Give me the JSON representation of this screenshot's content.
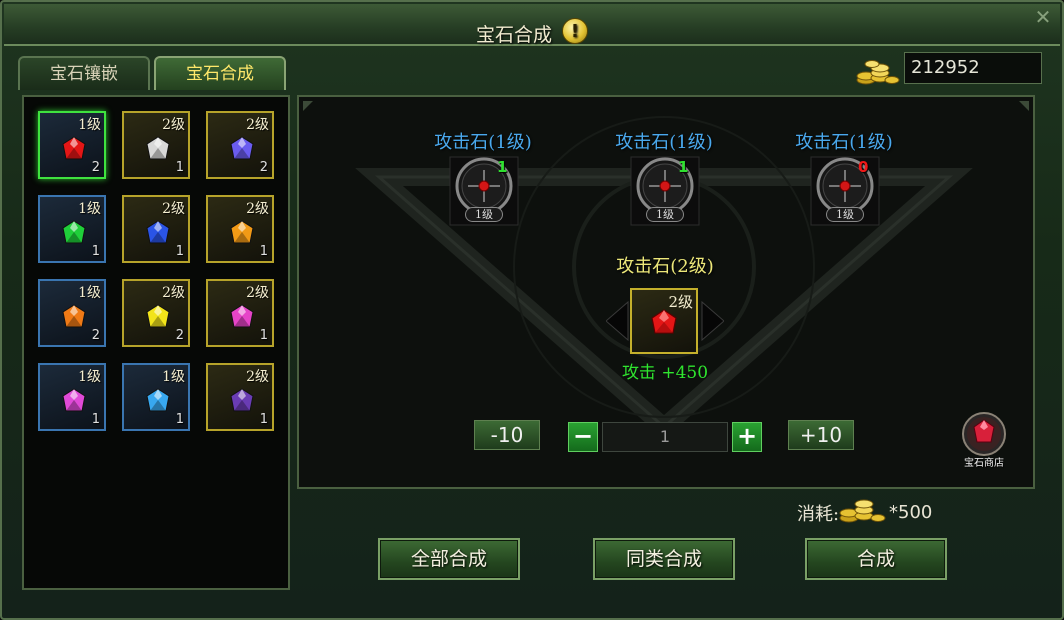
{
  "window": {
    "title": "宝石合成"
  },
  "tabs": [
    {
      "label": "宝石镶嵌",
      "active": false
    },
    {
      "label": "宝石合成",
      "active": true
    }
  ],
  "gold": {
    "amount": "212952"
  },
  "gem_grid": [
    {
      "level": "1级",
      "count": "2",
      "color": "#e41616",
      "tier": 1,
      "selected": true
    },
    {
      "level": "2级",
      "count": "1",
      "color": "#d8d8d8",
      "tier": 2,
      "selected": false
    },
    {
      "level": "2级",
      "count": "2",
      "color": "#6a5cf0",
      "tier": 2,
      "selected": false
    },
    {
      "level": "1级",
      "count": "1",
      "color": "#1fcf3a",
      "tier": 1,
      "selected": false
    },
    {
      "level": "2级",
      "count": "1",
      "color": "#2a54e6",
      "tier": 2,
      "selected": false
    },
    {
      "level": "2级",
      "count": "1",
      "color": "#f29a16",
      "tier": 2,
      "selected": false
    },
    {
      "level": "1级",
      "count": "2",
      "color": "#f07a16",
      "tier": 1,
      "selected": false
    },
    {
      "level": "2级",
      "count": "2",
      "color": "#f2e41a",
      "tier": 2,
      "selected": false
    },
    {
      "level": "2级",
      "count": "1",
      "color": "#e644c8",
      "tier": 2,
      "selected": false
    },
    {
      "level": "1级",
      "count": "1",
      "color": "#e04ad8",
      "tier": 1,
      "selected": false
    },
    {
      "level": "1级",
      "count": "1",
      "color": "#38a8f0",
      "tier": 1,
      "selected": false
    },
    {
      "level": "2级",
      "count": "1",
      "color": "#6a3cb4",
      "tier": 2,
      "selected": false
    }
  ],
  "materials": [
    {
      "title": "攻击石(1级)",
      "count": "1",
      "count_color": "#2fe02f",
      "level_tag": "1级"
    },
    {
      "title": "攻击石(1级)",
      "count": "1",
      "count_color": "#2fe02f",
      "level_tag": "1级"
    },
    {
      "title": "攻击石(1级)",
      "count": "0",
      "count_color": "#f01818",
      "level_tag": "1级"
    }
  ],
  "result": {
    "title": "攻击石(2级)",
    "level": "2级",
    "stat": "攻击  +450",
    "color": "#e41616"
  },
  "quantity": {
    "minus10": "-10",
    "minus": "−",
    "value": "1",
    "plus": "+",
    "plus10": "+10"
  },
  "shop": {
    "label": "宝石商店"
  },
  "cost": {
    "label": "消耗:",
    "value": "*500"
  },
  "buttons": {
    "synth_all": "全部合成",
    "synth_same": "同类合成",
    "synth": "合成"
  }
}
